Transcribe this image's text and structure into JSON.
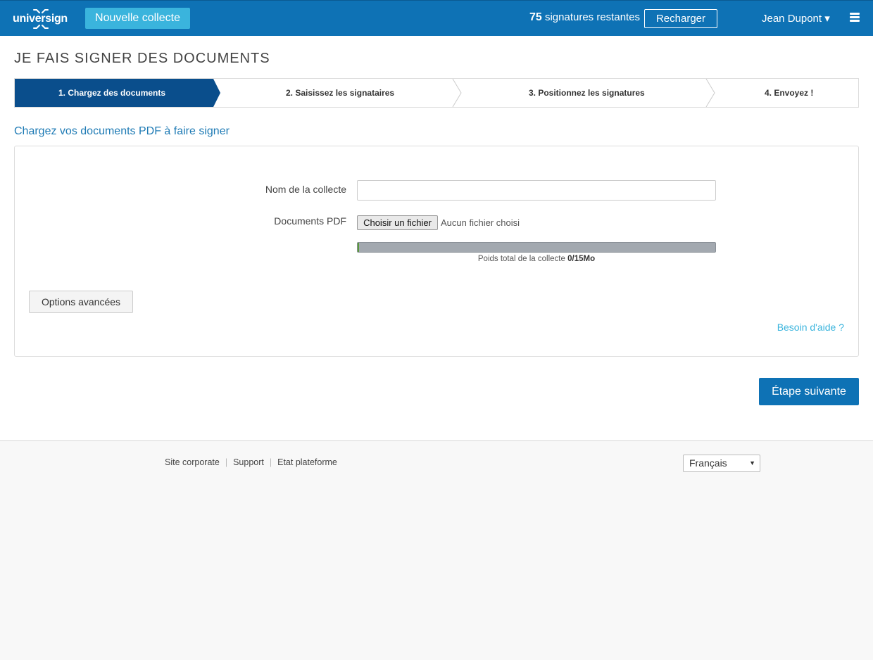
{
  "header": {
    "logo_text": "universign",
    "new_collection_label": "Nouvelle collecte",
    "signatures_count": "75",
    "signatures_label": "signatures restantes",
    "recharge_label": "Recharger",
    "user_name": "Jean Dupont ▾",
    "menu_icon": "hamburger-icon"
  },
  "page": {
    "title": "JE FAIS SIGNER DES DOCUMENTS",
    "subtitle": "Chargez vos documents PDF à faire signer"
  },
  "steps": [
    {
      "label": "1. Chargez des documents",
      "active": true
    },
    {
      "label": "2. Saisissez les signataires",
      "active": false
    },
    {
      "label": "3. Positionnez les signatures",
      "active": false
    },
    {
      "label": "4. Envoyez !",
      "active": false
    }
  ],
  "form": {
    "collection_name_label": "Nom de la collecte",
    "collection_name_value": "",
    "documents_label": "Documents PDF",
    "file_button_label": "Choisir un fichier",
    "file_status": "Aucun fichier choisi",
    "upload_progress": 0,
    "weight_label": "Poids total de la collecte",
    "weight_value": "0/15Mo",
    "options_label": "Options avancées",
    "help_link": "Besoin d'aide ?"
  },
  "actions": {
    "next_label": "Étape suivante"
  },
  "footer": {
    "links": [
      "Site corporate",
      "Support",
      "Etat plateforme"
    ],
    "language": "Français"
  },
  "colors": {
    "primary": "#0e72b5",
    "accent": "#3ab4dd",
    "active_step": "#0a4e8c",
    "link": "#1f7bb5"
  }
}
